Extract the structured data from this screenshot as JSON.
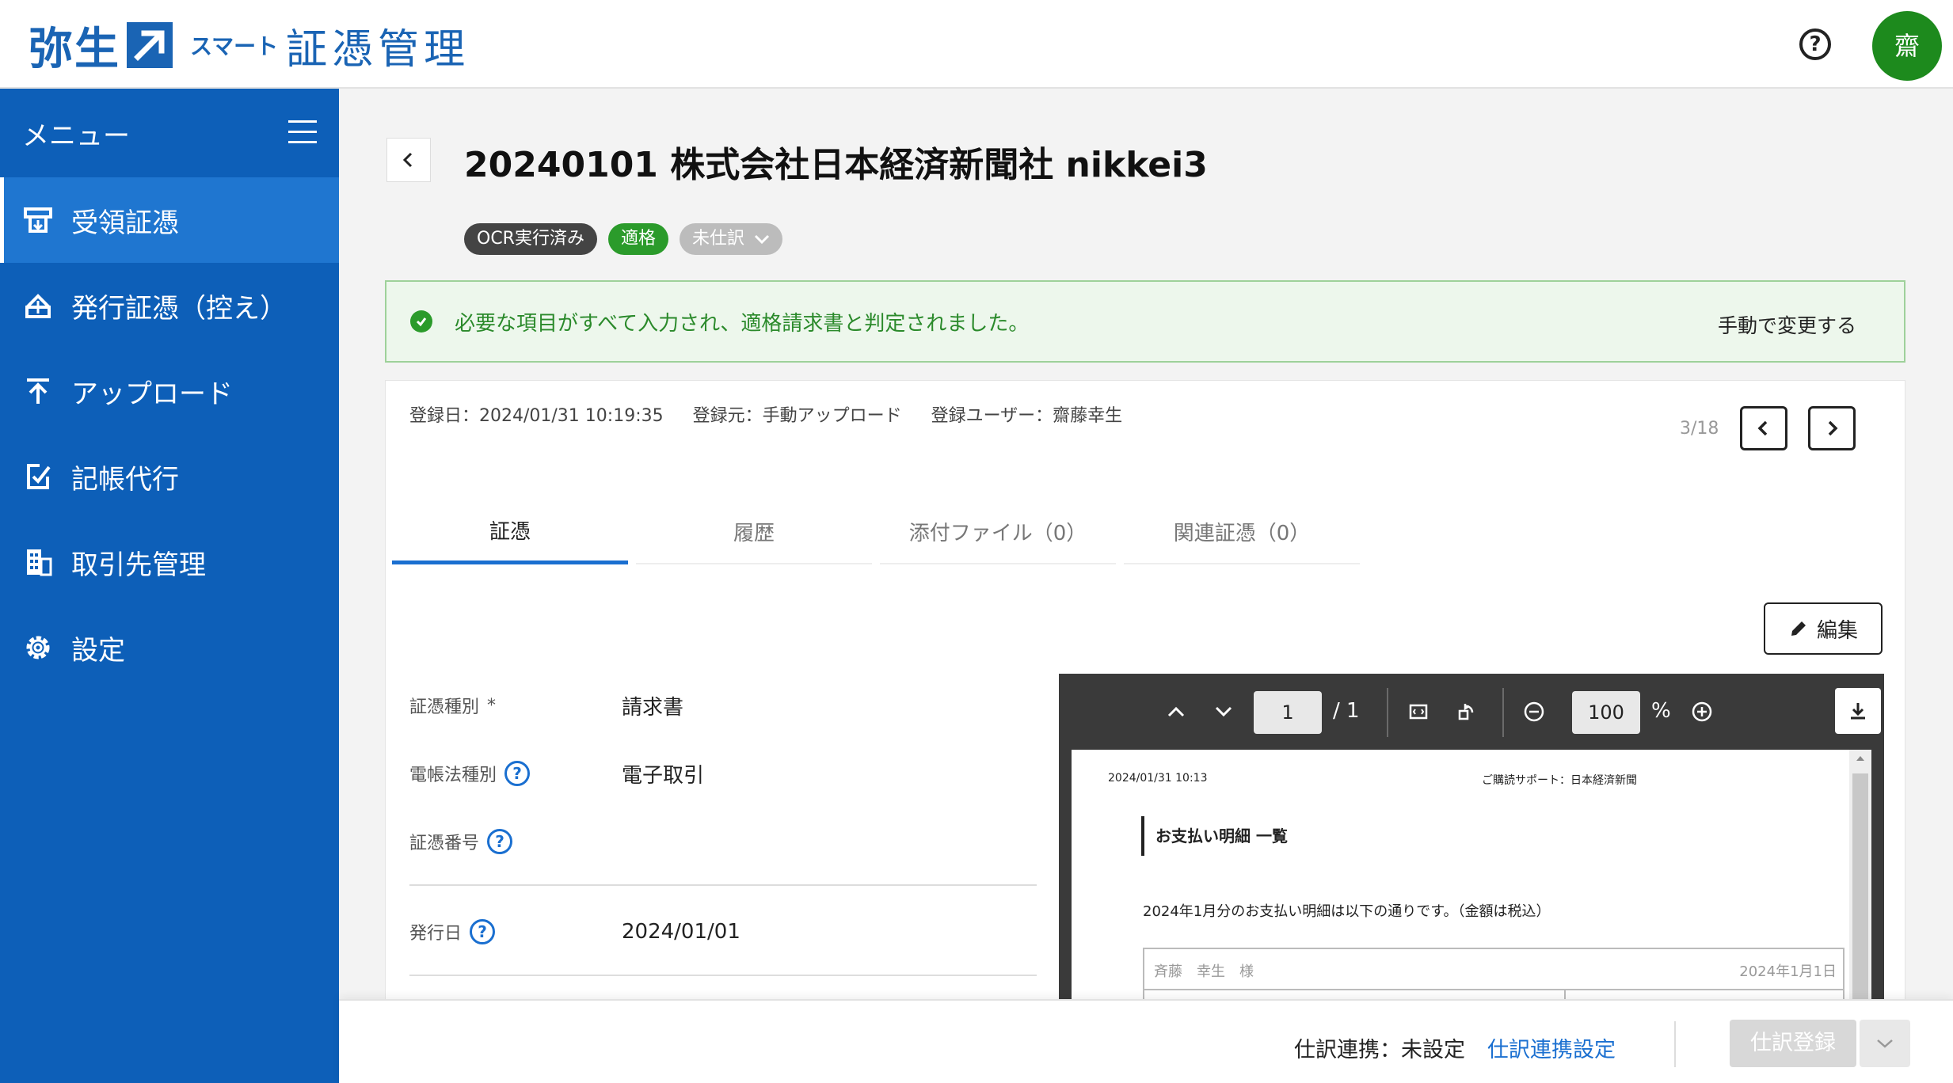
{
  "header": {
    "logo_main": "弥生",
    "logo_smart": "スマート",
    "logo_product": "証憑管理",
    "help": "?",
    "avatar": "齋"
  },
  "sidebar": {
    "menu_label": "メニュー",
    "items": [
      {
        "label": "受領証憑",
        "icon": "receive-icon",
        "active": true
      },
      {
        "label": "発行証憑（控え）",
        "icon": "issue-icon",
        "active": false
      },
      {
        "label": "アップロード",
        "icon": "upload-icon",
        "active": false
      },
      {
        "label": "記帳代行",
        "icon": "bookkeeping-icon",
        "active": false
      },
      {
        "label": "取引先管理",
        "icon": "building-icon",
        "active": false
      },
      {
        "label": "設定",
        "icon": "gear-icon",
        "active": false
      }
    ]
  },
  "main": {
    "title": "20240101 株式会社日本経済新聞社 nikkei3",
    "badges": {
      "ocr": "OCR実行済み",
      "qualified": "適格",
      "unjournalized": "未仕訳"
    },
    "alert": {
      "message": "必要な項目がすべて入力され、適格請求書と判定されました。",
      "link": "手動で変更する"
    },
    "meta": {
      "registered": "登録日：2024/01/31 10:19:35",
      "source": "登録元：手動アップロード",
      "user": "登録ユーザー：齋藤幸生"
    },
    "pager": {
      "count": "3/18"
    },
    "tabs": [
      "証憑",
      "履歴",
      "添付ファイル（0）",
      "関連証憑（0）"
    ],
    "edit_label": "編集",
    "fields": [
      {
        "label": "証憑種別",
        "required": "*",
        "value": "請求書"
      },
      {
        "label": "電帳法種別",
        "value": "電子取引"
      },
      {
        "label": "証憑番号",
        "value": ""
      },
      {
        "label": "発行日",
        "value": "2024/01/01"
      }
    ]
  },
  "viewer": {
    "page_current": "1",
    "page_total": "/ 1",
    "zoom": "100",
    "zoom_unit": "%",
    "doc": {
      "datetime": "2024/01/31 10:13",
      "support": "ご購読サポート：日本経済新聞",
      "heading": "お支払い明細 一覧",
      "intro": "2024年1月分のお支払い明細は以下の通りです。（金額は税込）",
      "name": "斉藤　幸生　様",
      "table_date": "2024年1月1日"
    }
  },
  "footer": {
    "status": "仕訳連携：未設定",
    "link": "仕訳連携設定",
    "register": "仕訳登録"
  },
  "colors": {
    "brand": "#1a64b4",
    "sidebar": "#0d5fb8",
    "sidebar_active": "#1f76d0",
    "success": "#2b9b2b",
    "link": "#1a6fd0"
  }
}
